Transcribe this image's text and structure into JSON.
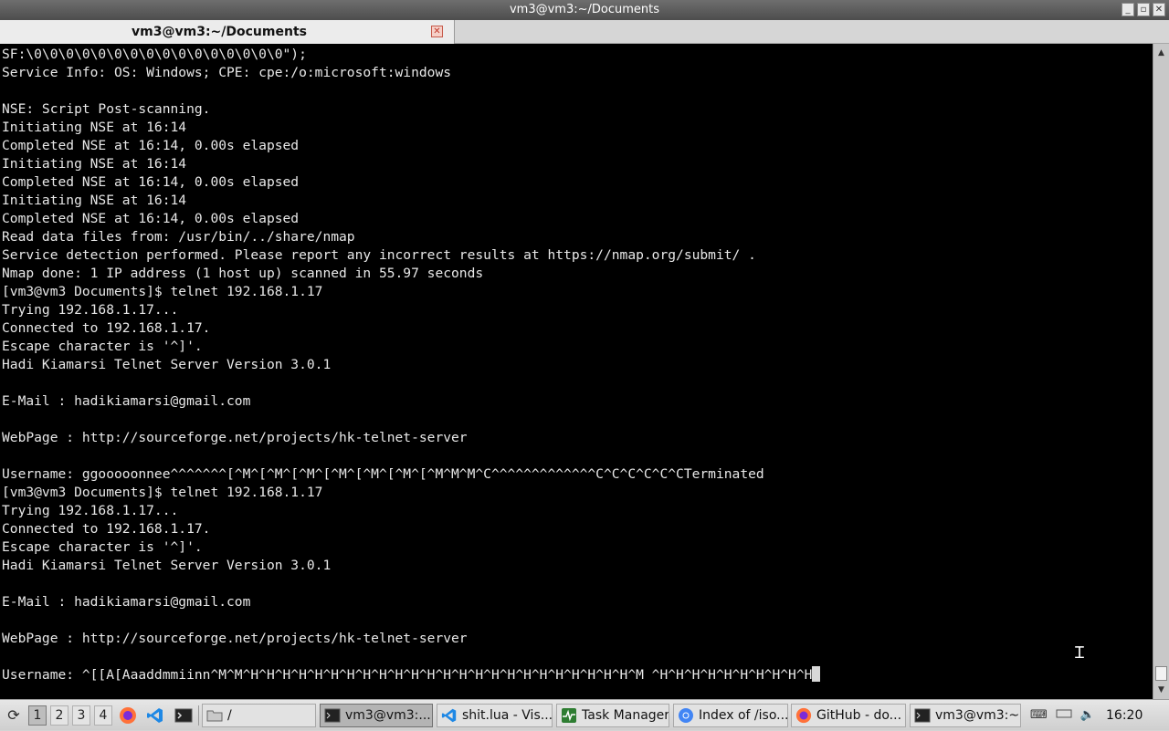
{
  "window": {
    "title": "vm3@vm3:~/Documents",
    "controls": {
      "minimize": "_",
      "maximize": "▫",
      "close": "✕"
    }
  },
  "tab": {
    "label": "vm3@vm3:~/Documents",
    "close": "✕"
  },
  "terminal": {
    "lines": [
      "SF:\\0\\0\\0\\0\\0\\0\\0\\0\\0\\0\\0\\0\\0\\0\\0\\0\");",
      "Service Info: OS: Windows; CPE: cpe:/o:microsoft:windows",
      "",
      "NSE: Script Post-scanning.",
      "Initiating NSE at 16:14",
      "Completed NSE at 16:14, 0.00s elapsed",
      "Initiating NSE at 16:14",
      "Completed NSE at 16:14, 0.00s elapsed",
      "Initiating NSE at 16:14",
      "Completed NSE at 16:14, 0.00s elapsed",
      "Read data files from: /usr/bin/../share/nmap",
      "Service detection performed. Please report any incorrect results at https://nmap.org/submit/ .",
      "Nmap done: 1 IP address (1 host up) scanned in 55.97 seconds",
      "[vm3@vm3 Documents]$ telnet 192.168.1.17",
      "Trying 192.168.1.17...",
      "Connected to 192.168.1.17.",
      "Escape character is '^]'.",
      "Hadi Kiamarsi Telnet Server Version 3.0.1",
      "",
      "E-Mail : hadikiamarsi@gmail.com",
      "",
      "WebPage : http://sourceforge.net/projects/hk-telnet-server",
      "",
      "Username: ggooooonnee^^^^^^^[^M^[^M^[^M^[^M^[^M^[^M^[^M^M^M^C^^^^^^^^^^^^^C^C^C^C^C^CTerminated",
      "[vm3@vm3 Documents]$ telnet 192.168.1.17",
      "Trying 192.168.1.17...",
      "Connected to 192.168.1.17.",
      "Escape character is '^]'.",
      "Hadi Kiamarsi Telnet Server Version 3.0.1",
      "",
      "E-Mail : hadikiamarsi@gmail.com",
      "",
      "WebPage : http://sourceforge.net/projects/hk-telnet-server",
      "",
      "Username: ^[[A[Aaaddmmiinn^M^M^H^H^H^H^H^H^H^H^H^H^H^H^H^H^H^H^H^H^H^H^H^H^H^H^M ^H^H^H^H^H^H^H^H^H^H"
    ]
  },
  "taskbar": {
    "workspaces": [
      "1",
      "2",
      "3",
      "4"
    ],
    "active_workspace": "1",
    "tasks": [
      {
        "label": "/",
        "icon": "folder-icon"
      },
      {
        "label": "vm3@vm3:...",
        "icon": "terminal-icon",
        "active": true
      },
      {
        "label": "shit.lua - Vis...",
        "icon": "vscode-icon"
      },
      {
        "label": "Task Manager",
        "icon": "task-manager-icon"
      },
      {
        "label": "Index of /iso...",
        "icon": "chromium-icon"
      },
      {
        "label": "GitHub - do...",
        "icon": "firefox-icon"
      },
      {
        "label": "vm3@vm3:~",
        "icon": "terminal-icon"
      }
    ],
    "clock": "16:20"
  },
  "colors": {
    "terminal_bg": "#000000",
    "terminal_fg": "#e8e8e8",
    "titlebar": "#5a5a5a",
    "taskbar": "#dcdcdc",
    "firefox": "#ff7139",
    "vscode": "#1e88e5",
    "chromium": "#4285f4",
    "task_manager": "#2e7d32"
  }
}
